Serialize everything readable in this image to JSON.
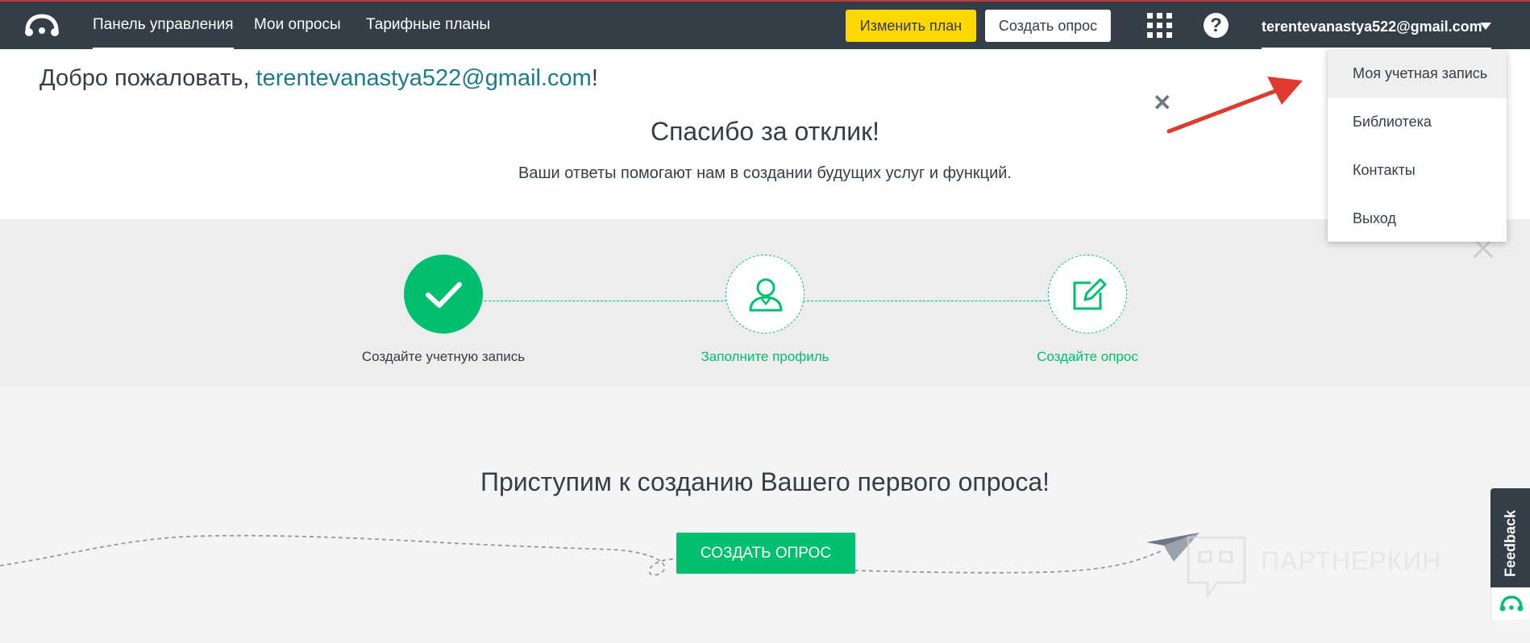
{
  "nav": {
    "links": [
      "Панель управления",
      "Мои опросы",
      "Тарифные планы"
    ],
    "upgrade_label": "Изменить план",
    "create_label": "Создать опрос",
    "user_email": "terentevanastya522@gmail.com"
  },
  "welcome": {
    "prefix": "Добро пожаловать, ",
    "email": "terentevanastya522@gmail.com",
    "suffix": "!"
  },
  "thanks": {
    "title": "Спасибо за отклик!",
    "subtitle": "Ваши ответы помогают нам в создании будущих услуг и функций."
  },
  "steps": [
    {
      "label": "Создайте учетную запись",
      "status": "done"
    },
    {
      "label": "Заполните профиль",
      "status": "todo"
    },
    {
      "label": "Создайте опрос",
      "status": "todo"
    }
  ],
  "dropdown": {
    "items": [
      "Моя учетная запись",
      "Библиотека",
      "Контакты",
      "Выход"
    ]
  },
  "create": {
    "title": "Приступим к созданию Вашего первого опроса!",
    "button_label": "Создать опрос"
  },
  "watermark": {
    "text": "ПАРТНЕРКИН"
  },
  "feedback": {
    "label": "Feedback"
  },
  "colors": {
    "nav_bg": "#333e48",
    "accent_green": "#00bf6f",
    "upgrade_yellow": "#fdd800",
    "link_teal": "#1b7b90",
    "arrow_red": "#e03a2f"
  }
}
